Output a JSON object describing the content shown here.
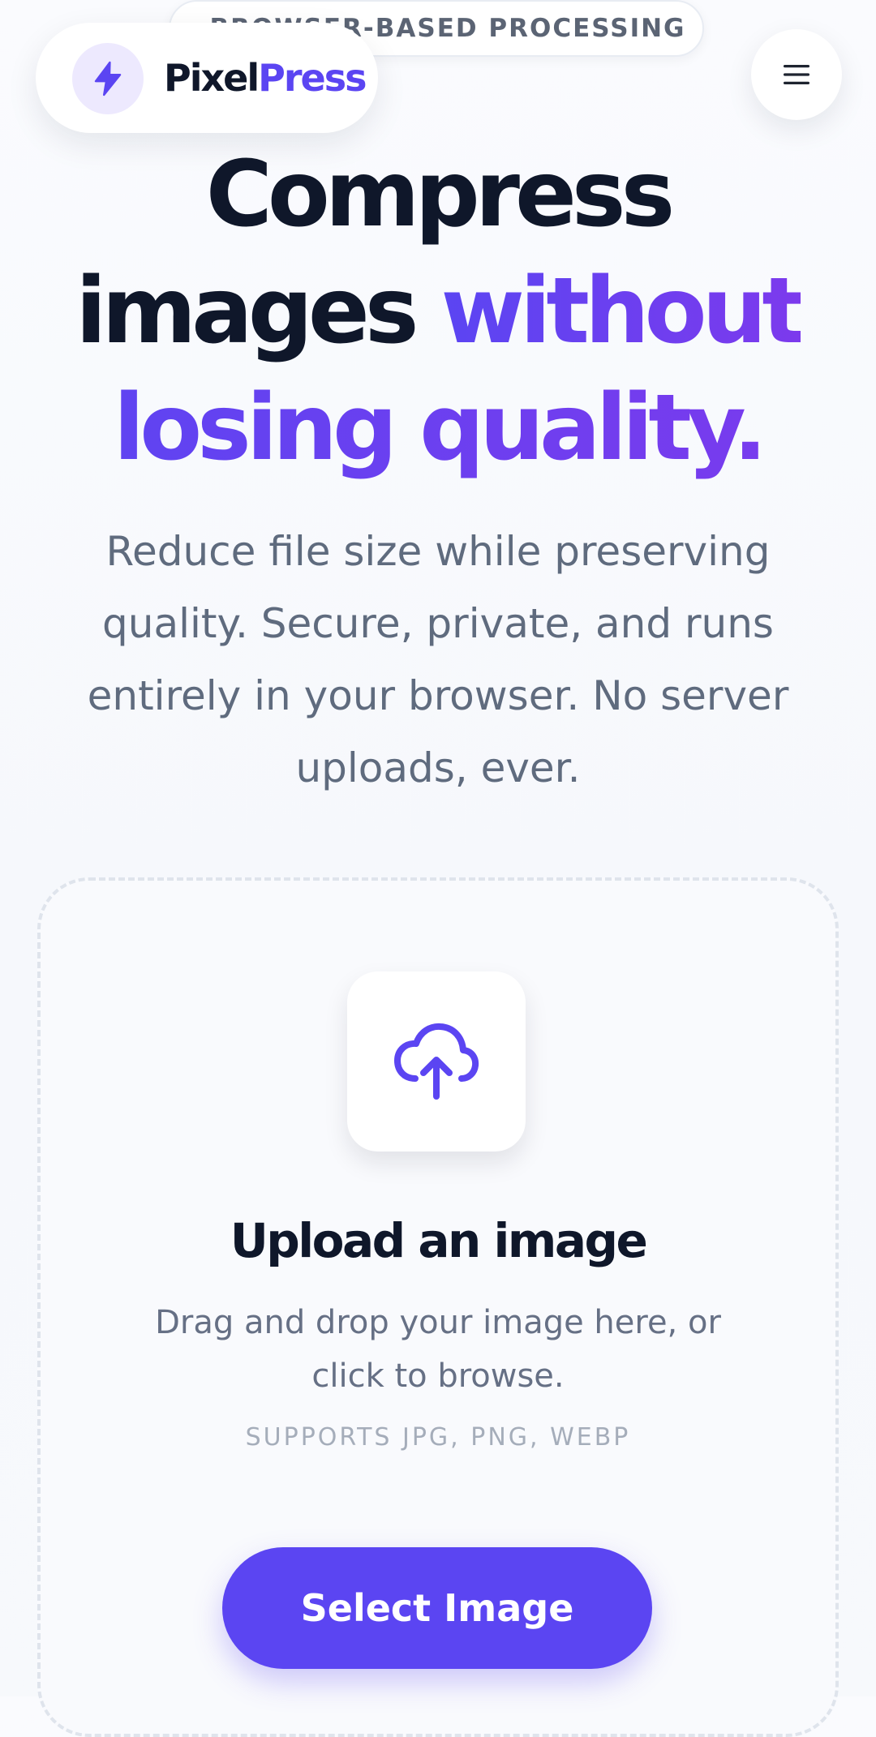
{
  "badge": {
    "text": "BROWSER-BASED PROCESSING",
    "dot_color": "#34d399"
  },
  "header": {
    "logo_icon": "lightning-bolt-icon",
    "logo_part1": "Pixel",
    "logo_part2": "Press",
    "menu_icon": "hamburger-menu-icon"
  },
  "hero": {
    "title_line1": "Compress",
    "title_line2_dark": "images ",
    "title_line2_accent": "without",
    "title_line3_accent": "losing quality.",
    "subtitle": "Reduce file size while preserving quality. Secure, private, and runs entirely in your browser. No server uploads, ever."
  },
  "upload": {
    "icon": "cloud-upload-icon",
    "title": "Upload an image",
    "description": "Drag and drop your image here, or click to browse.",
    "formats": "SUPPORTS JPG, PNG, WEBP",
    "button_label": "Select Image"
  },
  "colors": {
    "brand": "#5b45f2",
    "brand_gradient_end": "#7c3aed",
    "text_dark": "#0f172a",
    "text_muted": "#5f6b7e"
  }
}
